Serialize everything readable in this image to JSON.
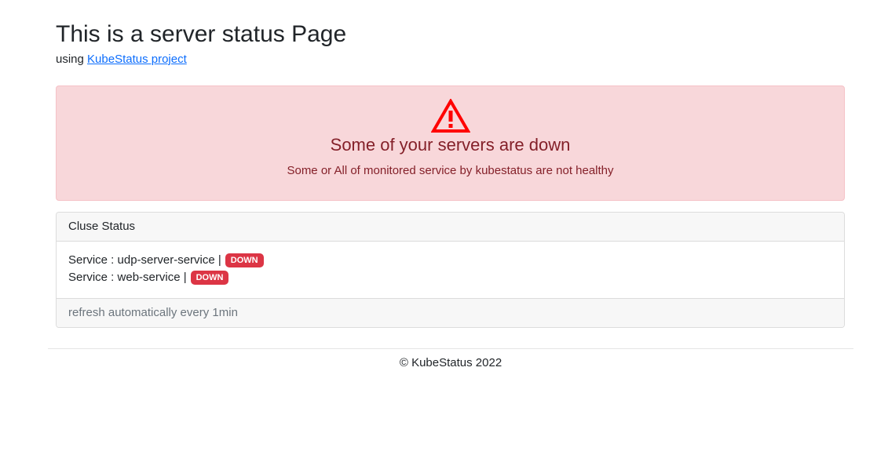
{
  "header": {
    "title": "This is a server status Page",
    "subtitle_prefix": "using",
    "project_link": "KubeStatus project"
  },
  "alert": {
    "icon": "warning-triangle-icon",
    "heading": "Some of your servers are down",
    "message": "Some or All of monitored service by kubestatus are not healthy",
    "colors": {
      "background": "#f8d7da",
      "text": "#842029",
      "icon": "#ff0000"
    }
  },
  "status_card": {
    "title": "Cluse Status",
    "services": [
      {
        "label": "Service : udp-server-service |",
        "status": "DOWN"
      },
      {
        "label": "Service : web-service |",
        "status": "DOWN"
      }
    ],
    "footer": "refresh automatically every 1min",
    "status_color": "#dc3545"
  },
  "footer": {
    "copyright": "© KubeStatus 2022"
  }
}
